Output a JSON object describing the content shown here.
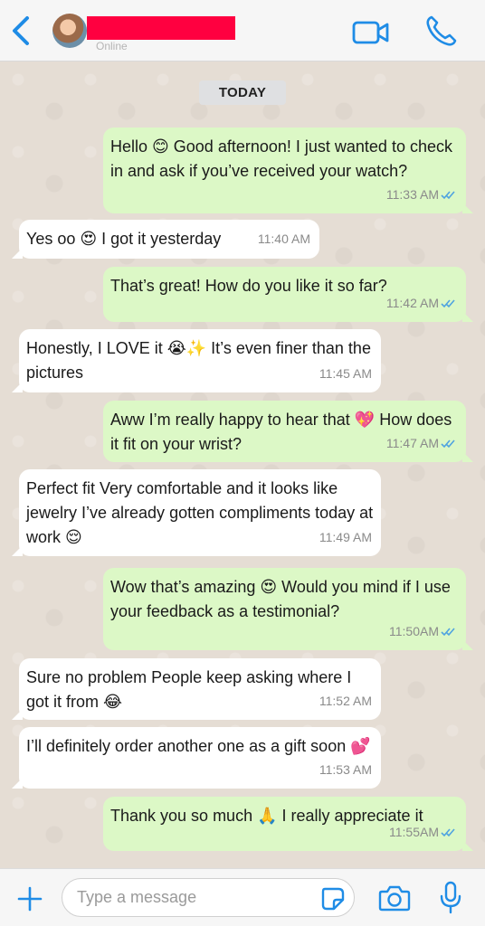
{
  "header": {
    "contact_status": "Online",
    "accent_color": "#1f8ce6"
  },
  "chat": {
    "date_label": "TODAY",
    "messages": [
      {
        "direction": "out",
        "text": "Hello 😊 Good afternoon! I just wanted to check in and ask if you’ve received your watch?",
        "time": "11:33 AM",
        "read": true
      },
      {
        "direction": "in",
        "text": "Yes oo 😍 I got it yesterday",
        "time": "11:40 AM"
      },
      {
        "direction": "out",
        "text": "That’s great! How do you like it so far?",
        "time": "11:42 AM",
        "read": true
      },
      {
        "direction": "in",
        "text": "Honestly, I LOVE it 😭✨ It’s even finer than the pictures",
        "time": "11:45 AM"
      },
      {
        "direction": "out",
        "text": "Aww I’m really happy to hear that 💖 How does it fit on your wrist?",
        "time": "11:47 AM",
        "read": true
      },
      {
        "direction": "in",
        "text": "Perfect fit Very comfortable and it looks like jewelry I’ve already gotten compliments today at work 😌",
        "time": "11:49 AM"
      },
      {
        "direction": "out",
        "text": "Wow that’s amazing 😍 Would you mind if I use your feedback as a testimonial?",
        "time": "11:50AM",
        "read": true
      },
      {
        "direction": "in",
        "text": "Sure no problem People keep asking where I got it from 😂",
        "time": "11:52 AM"
      },
      {
        "direction": "in",
        "text": "I’ll definitely order another one as a gift soon 💕",
        "time": "11:53 AM"
      },
      {
        "direction": "out",
        "text": "Thank you so much 🙏 I really appreciate it",
        "time": "11:55AM",
        "read": true
      }
    ]
  },
  "footer": {
    "input_placeholder": "Type a message",
    "input_value": ""
  },
  "icons": {
    "back": "chevron-left-icon",
    "video": "video-camera-icon",
    "call": "phone-icon",
    "plus": "plus-icon",
    "sticker": "sticker-icon",
    "camera": "camera-icon",
    "mic": "microphone-icon",
    "read_receipt": "double-check-icon"
  },
  "colors": {
    "outgoing_bubble": "#dcf8c6",
    "incoming_bubble": "#ffffff",
    "read_tick": "#4fa3e0",
    "redaction": "#ff0040"
  }
}
